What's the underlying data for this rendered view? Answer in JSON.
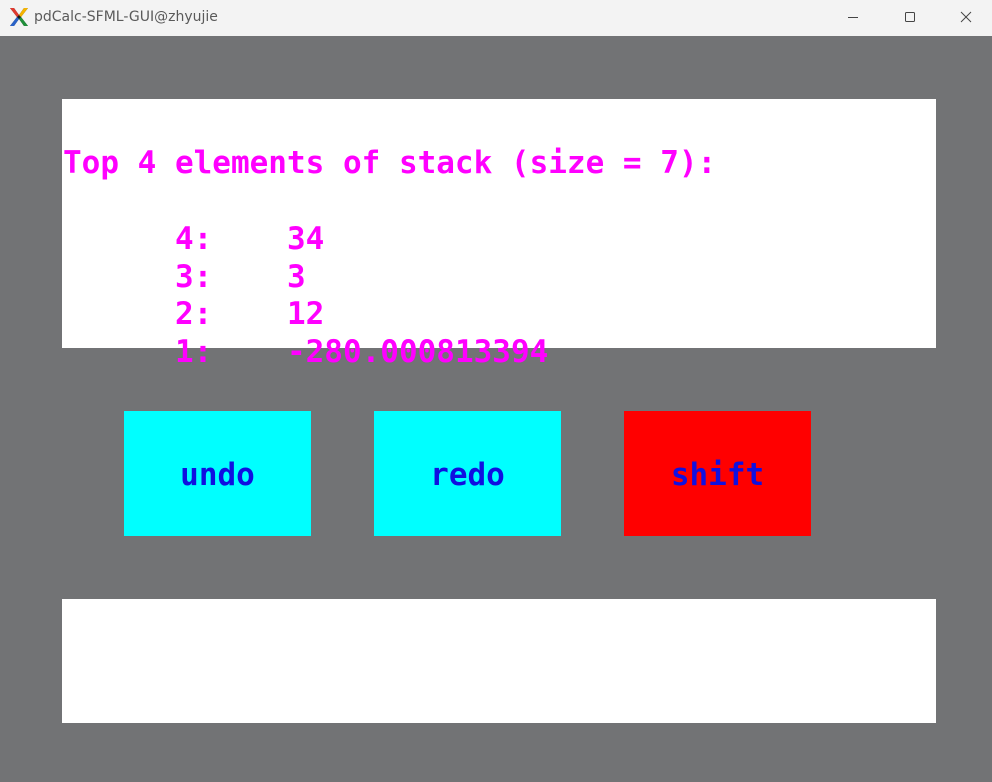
{
  "window": {
    "title": "pdCalc-SFML-GUI@zhyujie",
    "controls": [
      "minimize",
      "maximize",
      "close"
    ]
  },
  "stack_display": {
    "header": "Top 4 elements of stack (size = 7):",
    "rows": [
      {
        "index": "4:",
        "value": "34"
      },
      {
        "index": "3:",
        "value": "3"
      },
      {
        "index": "2:",
        "value": "12"
      },
      {
        "index": "1:",
        "value": "-280.000813394"
      }
    ],
    "text_color": "#ff00ff"
  },
  "buttons": {
    "undo": {
      "label": "undo",
      "color": "#00ffff"
    },
    "redo": {
      "label": "redo",
      "color": "#00ffff"
    },
    "shift": {
      "label": "shift",
      "color": "#ff0000"
    }
  },
  "input": {
    "value": ""
  },
  "colors": {
    "background": "#727375",
    "panel": "#ffffff",
    "button_text": "#1010e0"
  }
}
